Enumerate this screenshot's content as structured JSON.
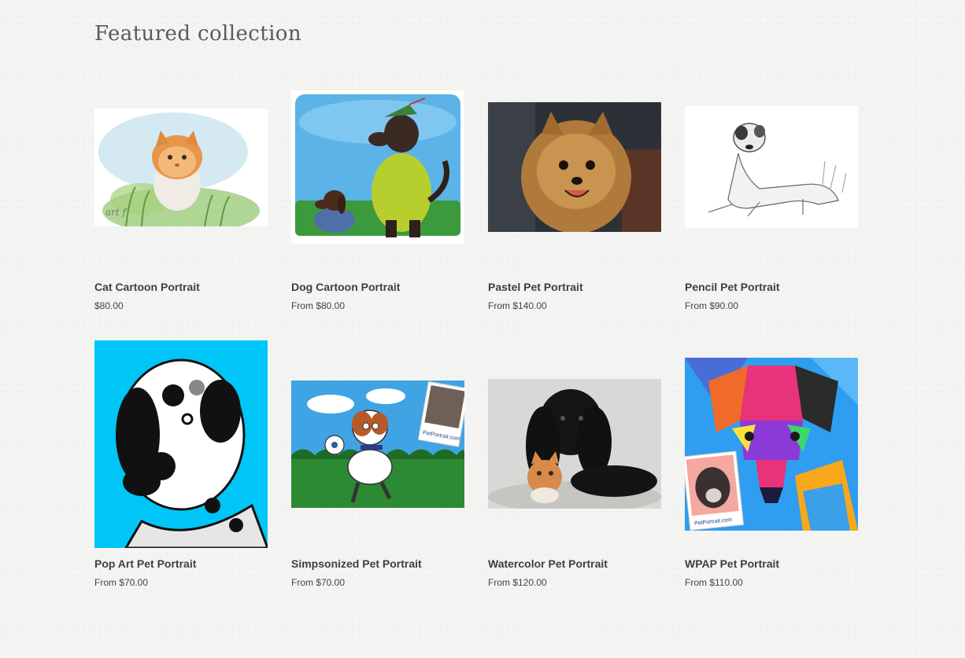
{
  "section": {
    "title": "Featured collection"
  },
  "products": [
    {
      "title": "Cat Cartoon Portrait",
      "price": "$80.00",
      "image_icon": "cat-watercolor-portrait-image"
    },
    {
      "title": "Dog Cartoon Portrait",
      "price": "From $80.00",
      "image_icon": "dogs-cartoon-portrait-image"
    },
    {
      "title": "Pastel Pet Portrait",
      "price": "From $140.00",
      "image_icon": "pomeranian-pastel-portrait-image"
    },
    {
      "title": "Pencil Pet Portrait",
      "price": "From $90.00",
      "image_icon": "dog-pencil-sketch-image"
    },
    {
      "title": "Pop Art Pet Portrait",
      "price": "From $70.00",
      "image_icon": "dalmatian-pop-art-image"
    },
    {
      "title": "Simpsonized Pet Portrait",
      "price": "From $70.00",
      "image_icon": "dog-simpsonized-cartoon-image"
    },
    {
      "title": "Watercolor Pet Portrait",
      "price": "From $120.00",
      "image_icon": "spaniel-and-cat-watercolor-image"
    },
    {
      "title": "WPAP Pet Portrait",
      "price": "From $110.00",
      "image_icon": "dog-wpap-colorful-image"
    }
  ],
  "image_overlay_text": {
    "signature": "art f",
    "watermark": "PetPortrait.com"
  },
  "colors": {
    "title_text": "#3f3f3f",
    "heading_text": "#5a5a5a",
    "page_background": "#f4f4f3"
  }
}
